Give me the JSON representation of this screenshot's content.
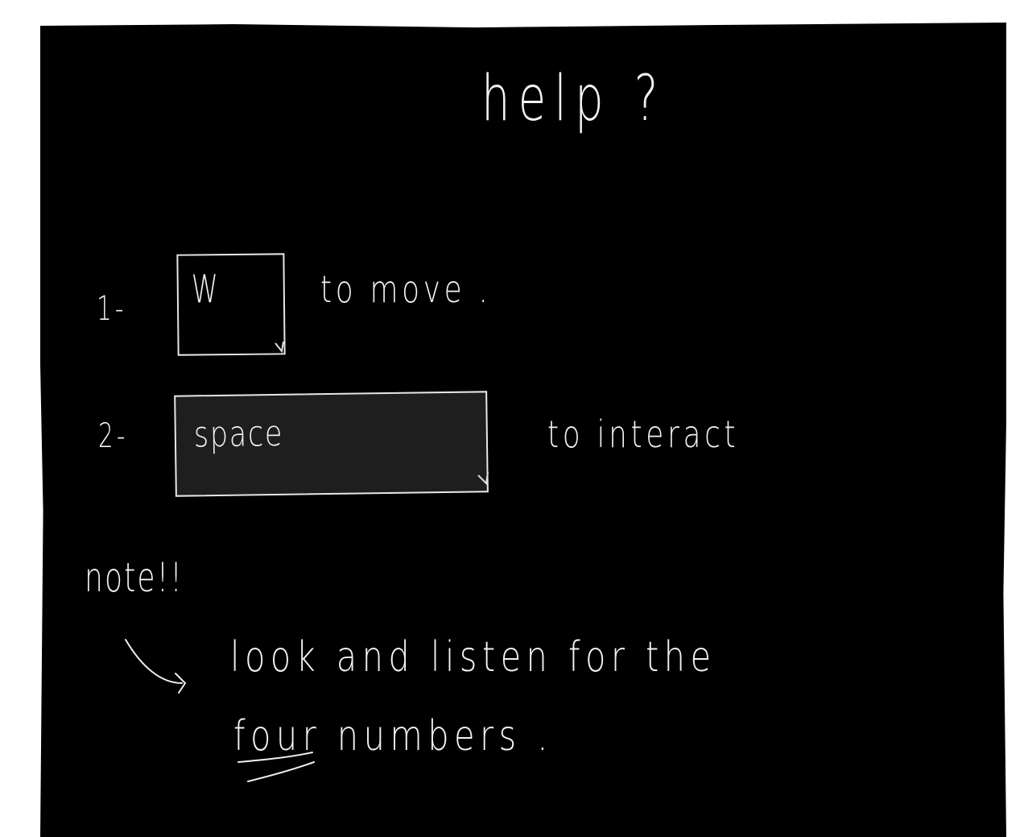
{
  "help_screen": {
    "title": "help ?",
    "steps": [
      {
        "number": "1-",
        "key": "W",
        "action": "to  move ."
      },
      {
        "number": "2-",
        "key": "space",
        "action": "to  interact"
      }
    ],
    "note": {
      "title": "note!!",
      "line1": "look and  listen  for the",
      "emphasis": "four",
      "line2_rest": "numbers ."
    }
  },
  "colors": {
    "background": "#000000",
    "page_margin": "#ffffff",
    "ink": "#f2f2f2",
    "space_key_fill": "#1e1e1e"
  },
  "icons": {
    "note_arrow": "curved-arrow-icon",
    "emphasis_underline": "double-underline-icon"
  }
}
